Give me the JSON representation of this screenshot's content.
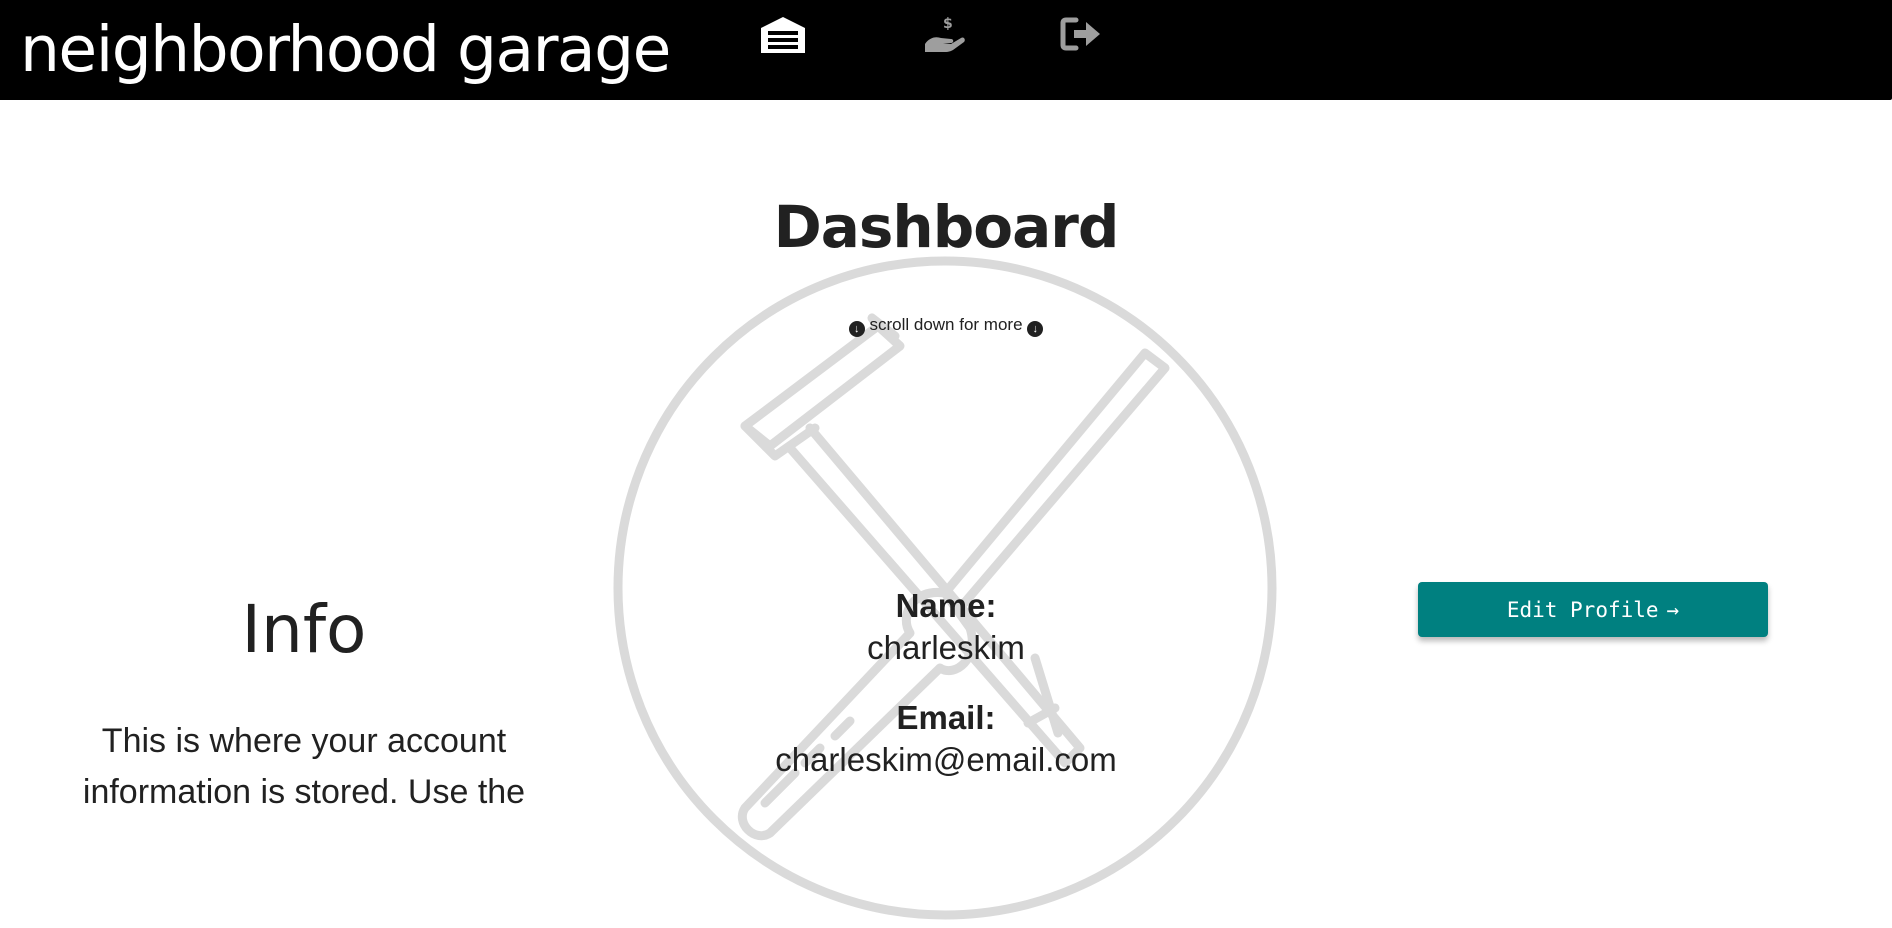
{
  "navbar": {
    "brand": "neighborhood garage",
    "icons": [
      {
        "name": "garage-icon",
        "color": "#ffffff"
      },
      {
        "name": "hand-dollar-icon",
        "color": "#9e9e9e"
      },
      {
        "name": "sign-out-icon",
        "color": "#9e9e9e"
      }
    ]
  },
  "main": {
    "title": "Dashboard",
    "scroll_hint": "scroll down for more",
    "info": {
      "title": "Info",
      "text": "This is where your account information is stored. Use the"
    },
    "profile": {
      "name_label": "Name:",
      "name_value": "charleskim",
      "email_label": "Email:",
      "email_value": "charleskim@email.com"
    },
    "edit_button": {
      "label": "Edit Profile",
      "arrow": "→",
      "color": "#008080"
    },
    "watermark_icon": "hammer-screwdriver-logo-icon"
  }
}
